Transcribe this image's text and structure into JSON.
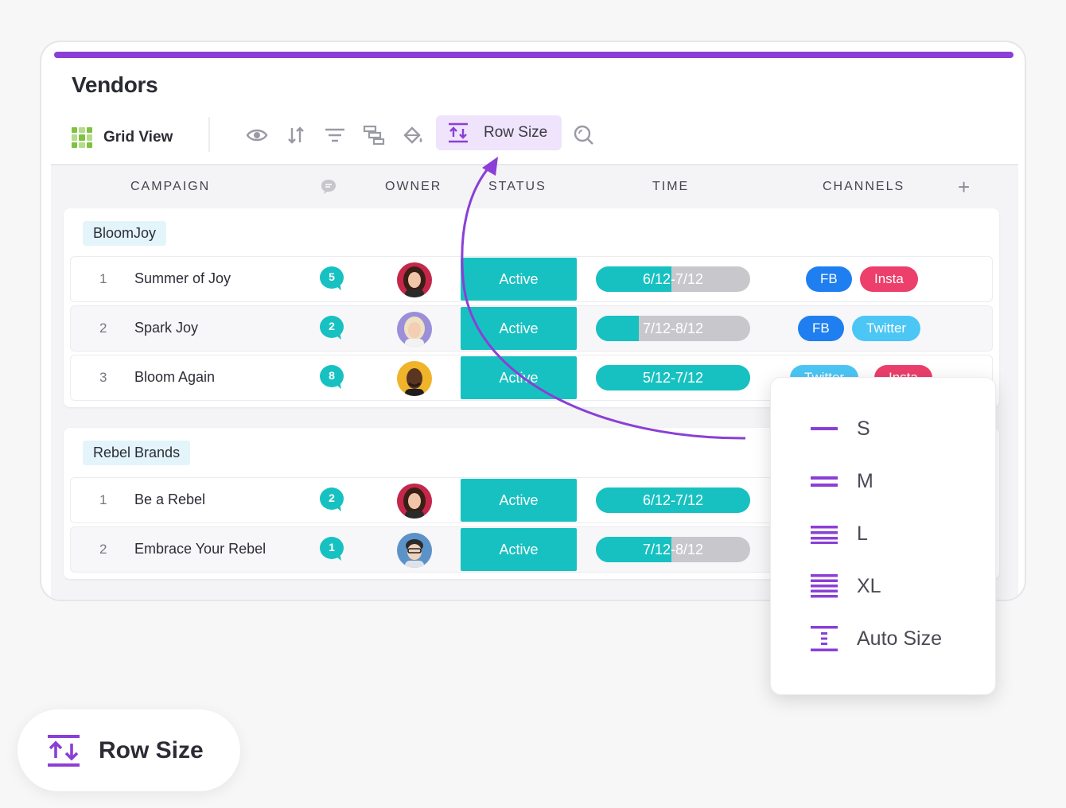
{
  "app": {
    "title": "Vendors",
    "view_label": "Grid View",
    "row_size_label": "Row Size",
    "colors": {
      "accent": "#8b3fd6",
      "teal": "#17c1c1",
      "fb": "#1f7ff0",
      "insta": "#ec3f6b",
      "twitter": "#4cc6f5",
      "grey": "#c8c8cc"
    }
  },
  "toolbar_icons": [
    "eye-icon",
    "sort-icon",
    "filter-icon",
    "group-icon",
    "paint-bucket-icon",
    "row-size-icon",
    "search-icon"
  ],
  "columns": {
    "campaign": "CAMPAIGN",
    "owner": "OWNER",
    "status": "STATUS",
    "time": "TIME",
    "channels": "CHANNELS",
    "add": "+"
  },
  "groups": [
    {
      "name": "BloomJoy",
      "rows": [
        {
          "num": "1",
          "name": "Summer of Joy",
          "comments": "5",
          "status": "Active",
          "time": "6/12-7/12",
          "time_progress": 0.49,
          "channels": [
            "FB",
            "Insta"
          ]
        },
        {
          "num": "2",
          "name": "Spark Joy",
          "comments": "2",
          "status": "Active",
          "time": "7/12-8/12",
          "time_progress": 0.28,
          "channels": [
            "FB",
            "Twitter"
          ]
        },
        {
          "num": "3",
          "name": "Bloom Again",
          "comments": "8",
          "status": "Active",
          "time": "5/12-7/12",
          "time_progress": 1.0,
          "channels": [
            "Twitter",
            "Insta"
          ]
        }
      ]
    },
    {
      "name": "Rebel Brands",
      "rows": [
        {
          "num": "1",
          "name": "Be a Rebel",
          "comments": "2",
          "status": "Active",
          "time": "6/12-7/12",
          "time_progress": 1.0,
          "channels": []
        },
        {
          "num": "2",
          "name": "Embrace Your Rebel",
          "comments": "1",
          "status": "Active",
          "time": "7/12-8/12",
          "time_progress": 0.49,
          "channels": []
        }
      ]
    }
  ],
  "menu": {
    "items": [
      "S",
      "M",
      "L",
      "XL",
      "Auto Size"
    ]
  },
  "pill": {
    "label": "Row Size"
  }
}
